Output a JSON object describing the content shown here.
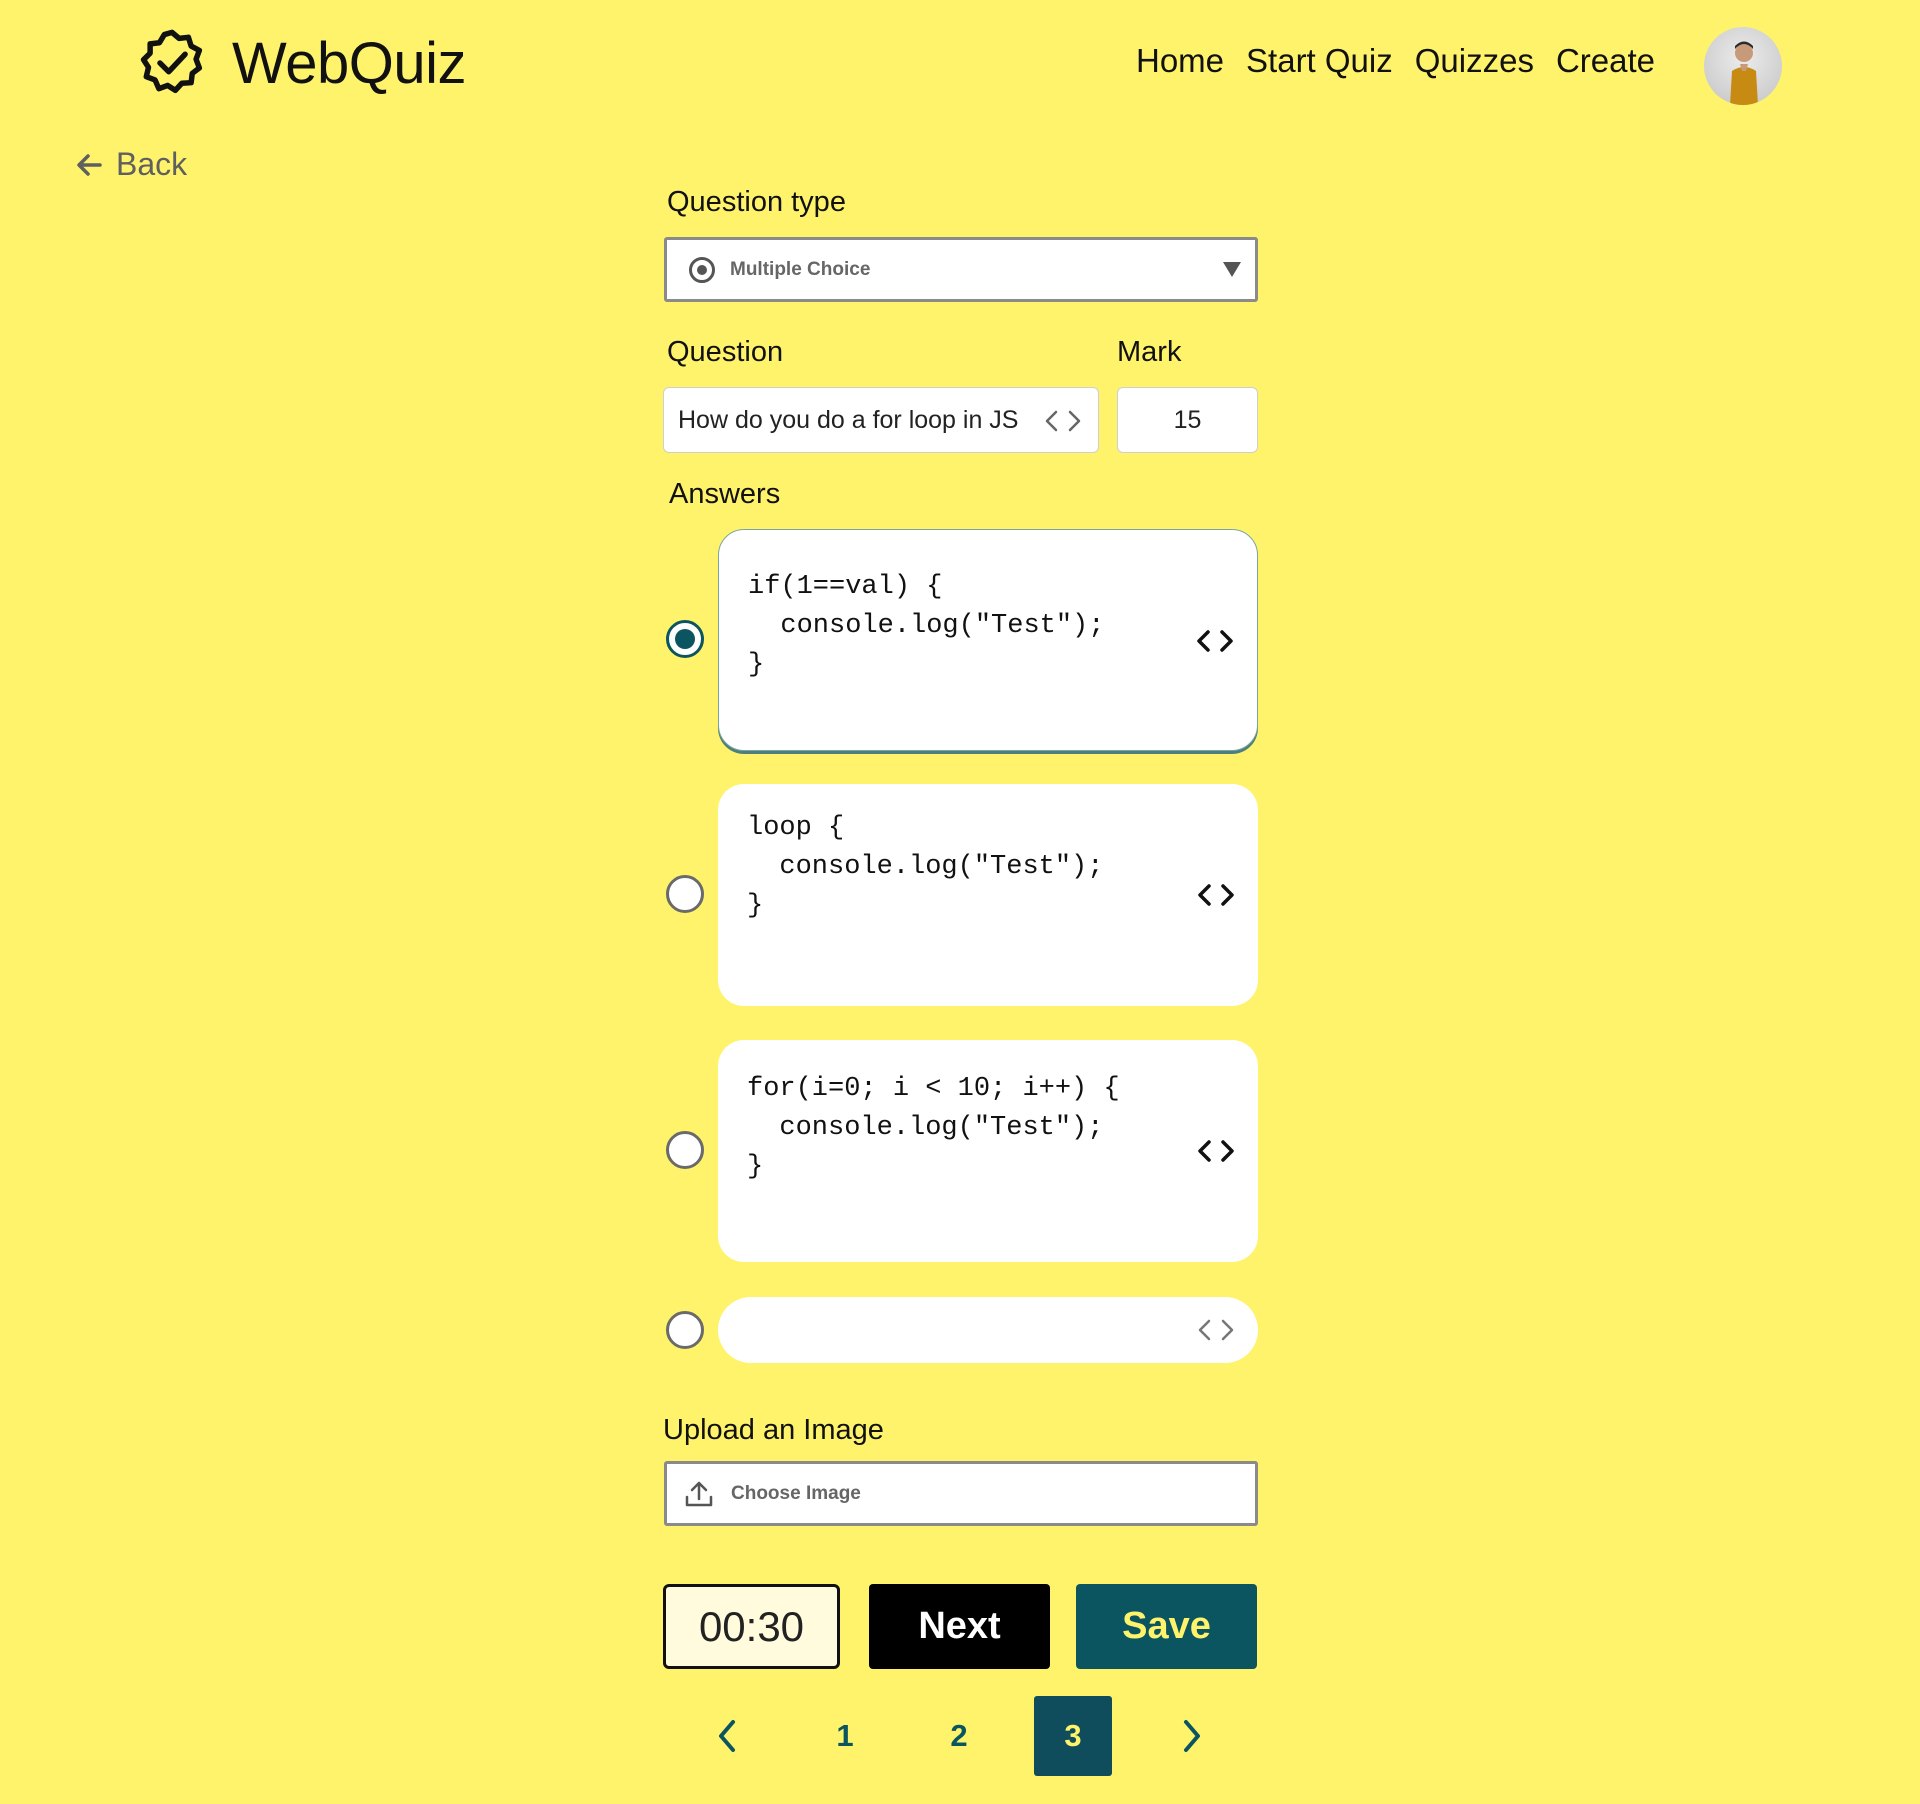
{
  "app": {
    "title": "WebQuiz"
  },
  "nav": {
    "items": [
      "Home",
      "Start Quiz",
      "Quizzes",
      "Create"
    ]
  },
  "back": {
    "label": "Back"
  },
  "question_type": {
    "label": "Question type",
    "value": "Multiple Choice"
  },
  "question": {
    "label": "Question",
    "value": "How do you do a for loop in JS"
  },
  "mark": {
    "label": "Mark",
    "value": "15"
  },
  "answers": {
    "label": "Answers",
    "items": [
      {
        "code": "if(1==val) {\n  console.log(\"Test\");\n}",
        "selected": true
      },
      {
        "code": "loop {\n  console.log(\"Test\");\n}",
        "selected": false
      },
      {
        "code": "for(i=0; i < 10; i++) {\n  console.log(\"Test\");\n}",
        "selected": false
      },
      {
        "code": "",
        "selected": false
      }
    ]
  },
  "upload": {
    "label": "Upload an Image",
    "button": "Choose Image"
  },
  "timer": {
    "value": "00:30"
  },
  "buttons": {
    "next": "Next",
    "save": "Save"
  },
  "pagination": {
    "pages": [
      "1",
      "2",
      "3"
    ],
    "current": "3"
  },
  "colors": {
    "background": "#fff36b",
    "accent": "#0b5561",
    "active_page": "#0f4c5c"
  }
}
